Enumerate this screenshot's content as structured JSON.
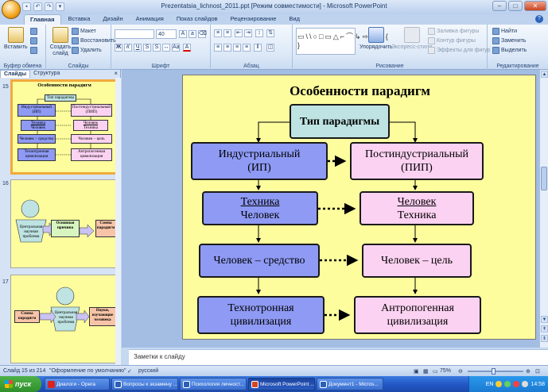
{
  "window": {
    "title": "Prezentatsia_lichnost_2011.ppt [Режим совместимости] - Microsoft PowerPoint"
  },
  "tabs": [
    "Главная",
    "Вставка",
    "Дизайн",
    "Анимация",
    "Показ слайдов",
    "Рецензирование",
    "Вид"
  ],
  "ribbon": {
    "clipboard": {
      "label": "Буфер обмена",
      "paste": "Вставить"
    },
    "slides": {
      "label": "Слайды",
      "new_slide": "Создать слайд",
      "layout": "Макет",
      "reset": "Восстановить",
      "delete": "Удалить"
    },
    "font": {
      "label": "Шрифт",
      "size": "40"
    },
    "paragraph": {
      "label": "Абзац"
    },
    "drawing": {
      "label": "Рисование",
      "arrange": "Упорядочить",
      "quick_styles": "Экспресс-стили",
      "fill": "Заливка фигуры",
      "outline": "Контур фигуры",
      "effects": "Эффекты для фигур"
    },
    "editing": {
      "label": "Редактирование",
      "find": "Найти",
      "replace": "Заменить",
      "select": "Выделить"
    }
  },
  "pane": {
    "tab_slides": "Слайды",
    "tab_outline": "Структура",
    "close": "×"
  },
  "thumbnails": {
    "t15": {
      "num": "15",
      "title": "Особенности парадигм",
      "top": "Тип парадигмы",
      "l1": "Индустриальный (ИП)",
      "r1": "Постиндустриальный (ПИП)",
      "l2a": "Техника",
      "l2b": "Человек",
      "r2a": "Человек",
      "r2b": "Техника",
      "l3": "Человек – средство",
      "r3": "Человек – цель",
      "l4": "Технотронная цивилизация",
      "r4": "Антропогенная цивилизация"
    },
    "t16": {
      "num": "16",
      "center": "Центральная научная проблема",
      "mid": "Основная причина",
      "right": "Смена парадигм"
    },
    "t17": {
      "num": "17",
      "left": "Смена парадигм",
      "center": "Центральная научная проблема",
      "right": "Науки, изучающие человека"
    }
  },
  "slide": {
    "title": "Особенности парадигм",
    "top_box": "Тип парадигмы",
    "left1_a": "Индустриальный",
    "left1_b": "(ИП)",
    "right1_a": "Постиндустриальный",
    "right1_b": "(ПИП)",
    "left2_a": "Техника",
    "left2_b": "Человек",
    "right2_a": "Человек",
    "right2_b": "Техника",
    "left3": "Человек – средство",
    "right3": "Человек – цель",
    "left4_a": "Технотронная",
    "left4_b": "цивилизация",
    "right4_a": "Антропогенная",
    "right4_b": "цивилизация"
  },
  "notes": {
    "placeholder": "Заметки к слайду"
  },
  "status": {
    "slide_info": "Слайд 15 из 214",
    "theme": "\"Оформление по умолчанию\"",
    "language": "русский",
    "zoom": "75%"
  },
  "taskbar": {
    "start": "пуск",
    "items": [
      "Диалоги - Opera",
      "Вопросы к экзамену ...",
      "Психология личност...",
      "Microsoft PowerPoint ...",
      "Документ1 - Micros..."
    ],
    "lang": "EN",
    "time": "14:58"
  },
  "colors": {
    "blue_box": "#8e9af4",
    "pink_box": "#fcd2f2",
    "teal_box": "#bfe3e3",
    "slide_bg": "#fdfd9e",
    "selection": "#f2a93b"
  }
}
